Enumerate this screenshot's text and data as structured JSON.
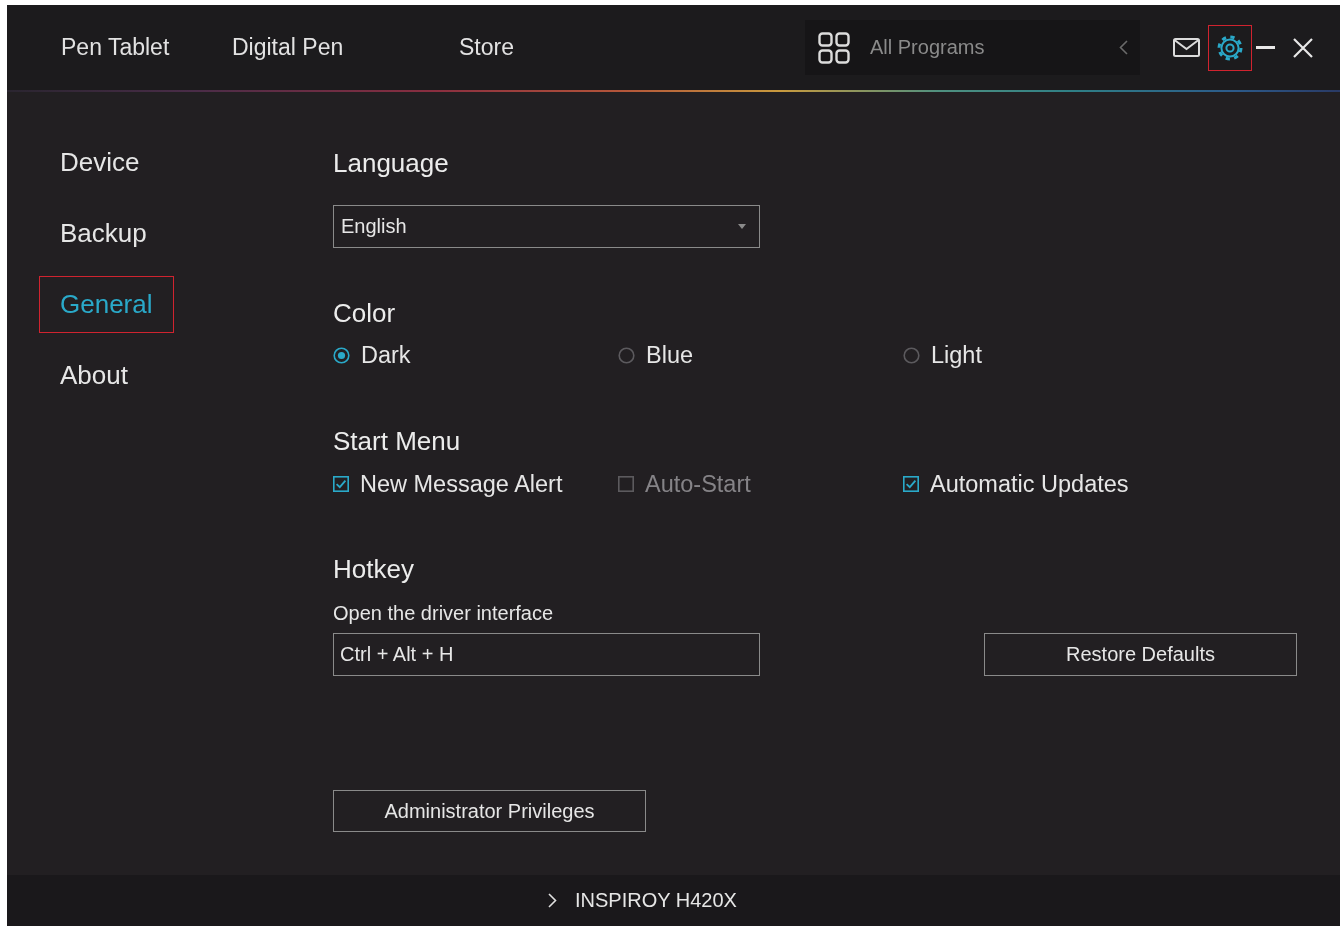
{
  "top_bar": {
    "tabs": [
      {
        "label": "Pen Tablet",
        "selected": false
      },
      {
        "label": "Digital Pen",
        "selected": false
      },
      {
        "label": "Store",
        "selected": false
      }
    ],
    "program_selector": {
      "value": "All Programs"
    },
    "settings_button": {
      "selected": true,
      "highlighted": true
    }
  },
  "sidebar": {
    "items": [
      {
        "label": "Device",
        "selected": false,
        "highlighted": false
      },
      {
        "label": "Backup",
        "selected": false,
        "highlighted": false
      },
      {
        "label": "General",
        "selected": true,
        "highlighted": true
      },
      {
        "label": "About",
        "selected": false,
        "highlighted": false
      }
    ]
  },
  "settings": {
    "language": {
      "title": "Language",
      "value": "English"
    },
    "color": {
      "title": "Color",
      "options": [
        {
          "label": "Dark",
          "selected": true
        },
        {
          "label": "Blue",
          "selected": false
        },
        {
          "label": "Light",
          "selected": false
        }
      ]
    },
    "start_menu": {
      "title": "Start Menu",
      "options": [
        {
          "label": "New Message Alert",
          "checked": true,
          "disabled": false
        },
        {
          "label": "Auto-Start",
          "checked": false,
          "disabled": true
        },
        {
          "label": "Automatic Updates",
          "checked": true,
          "disabled": false
        }
      ]
    },
    "hotkey": {
      "title": "Hotkey",
      "description": "Open the driver interface",
      "value": "Ctrl + Alt + H",
      "restore_button": "Restore Defaults"
    },
    "admin_button": "Administrator Privileges"
  },
  "footer": {
    "device": "INSPIROY H420X"
  }
}
